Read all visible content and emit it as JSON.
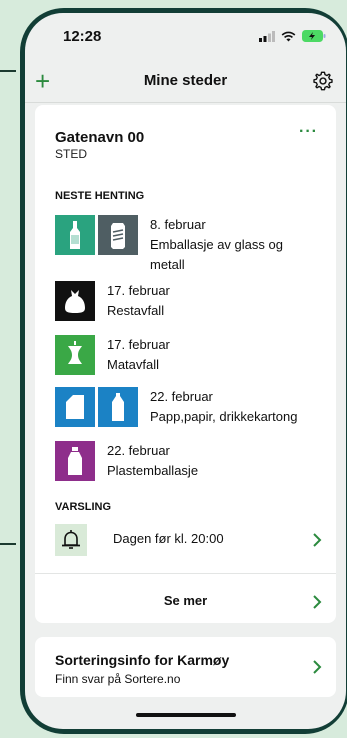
{
  "status": {
    "time": "12:28"
  },
  "nav": {
    "title": "Mine steder"
  },
  "place": {
    "name": "Gatenavn 00",
    "sub": "STED"
  },
  "pickups_heading": "NESTE HENTING",
  "pickups": [
    {
      "date": "8. februar",
      "type": "Emballasje av glass og metall",
      "icons": [
        "bottle-icon",
        "can-icon"
      ],
      "colors": [
        "#2aa37f",
        "#4f5e63"
      ]
    },
    {
      "date": "17. februar",
      "type": "Restavfall",
      "icons": [
        "trash-bag-icon"
      ],
      "colors": [
        "#111111"
      ]
    },
    {
      "date": "17. februar",
      "type": "Matavfall",
      "icons": [
        "apple-core-icon"
      ],
      "colors": [
        "#3aa846"
      ]
    },
    {
      "date": "22. februar",
      "type": "Papp,papir, drikkekartong",
      "icons": [
        "paper-icon",
        "carton-icon"
      ],
      "colors": [
        "#1b82c5",
        "#1b82c5"
      ]
    },
    {
      "date": "22. februar",
      "type": "Plastemballasje",
      "icons": [
        "plastic-bottle-icon"
      ],
      "colors": [
        "#8e2e8b"
      ]
    }
  ],
  "notif": {
    "heading": "VARSLING",
    "text": "Dagen før kl. 20:00",
    "icon": "bell-icon"
  },
  "more_label": "Se mer",
  "info": {
    "title": "Sorteringsinfo for Karmøy",
    "sub": "Finn svar på Sortere.no"
  },
  "colors": {
    "accent": "#2b8a3e",
    "frame": "#123e36",
    "background": "#d7ebdc"
  }
}
